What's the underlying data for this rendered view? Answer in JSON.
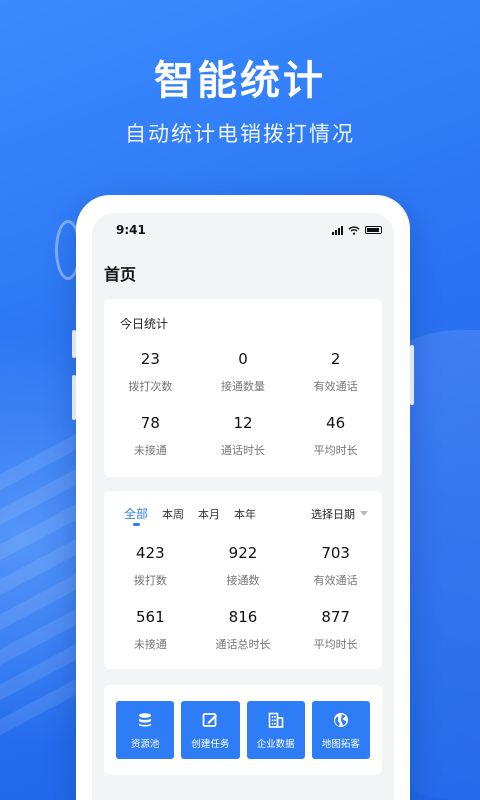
{
  "hero": {
    "title": "智能统计",
    "subtitle": "自动统计电销拨打情况"
  },
  "status_bar": {
    "time": "9:41"
  },
  "page": {
    "title": "首页"
  },
  "today": {
    "label": "今日统计",
    "stats": [
      {
        "value": "23",
        "label": "拨打次数"
      },
      {
        "value": "0",
        "label": "接通数量"
      },
      {
        "value": "2",
        "label": "有效通话"
      },
      {
        "value": "78",
        "label": "未接通"
      },
      {
        "value": "12",
        "label": "通话时长"
      },
      {
        "value": "46",
        "label": "平均时长"
      }
    ]
  },
  "period": {
    "tabs": [
      "全部",
      "本周",
      "本月",
      "本年"
    ],
    "active_tab": "全部",
    "date_picker_label": "选择日期",
    "stats": [
      {
        "value": "423",
        "label": "拨打数"
      },
      {
        "value": "922",
        "label": "接通数"
      },
      {
        "value": "703",
        "label": "有效通话"
      },
      {
        "value": "561",
        "label": "未接通"
      },
      {
        "value": "816",
        "label": "通话总时长"
      },
      {
        "value": "877",
        "label": "平均时长"
      }
    ]
  },
  "shortcuts": [
    {
      "label": "资源池",
      "icon": "database-icon"
    },
    {
      "label": "创建任务",
      "icon": "edit-icon"
    },
    {
      "label": "企业数据",
      "icon": "building-icon"
    },
    {
      "label": "地图拓客",
      "icon": "globe-icon"
    }
  ],
  "colors": {
    "brand": "#2f7df6",
    "background": "#2a72f2",
    "screen": "#f3f4f6"
  }
}
